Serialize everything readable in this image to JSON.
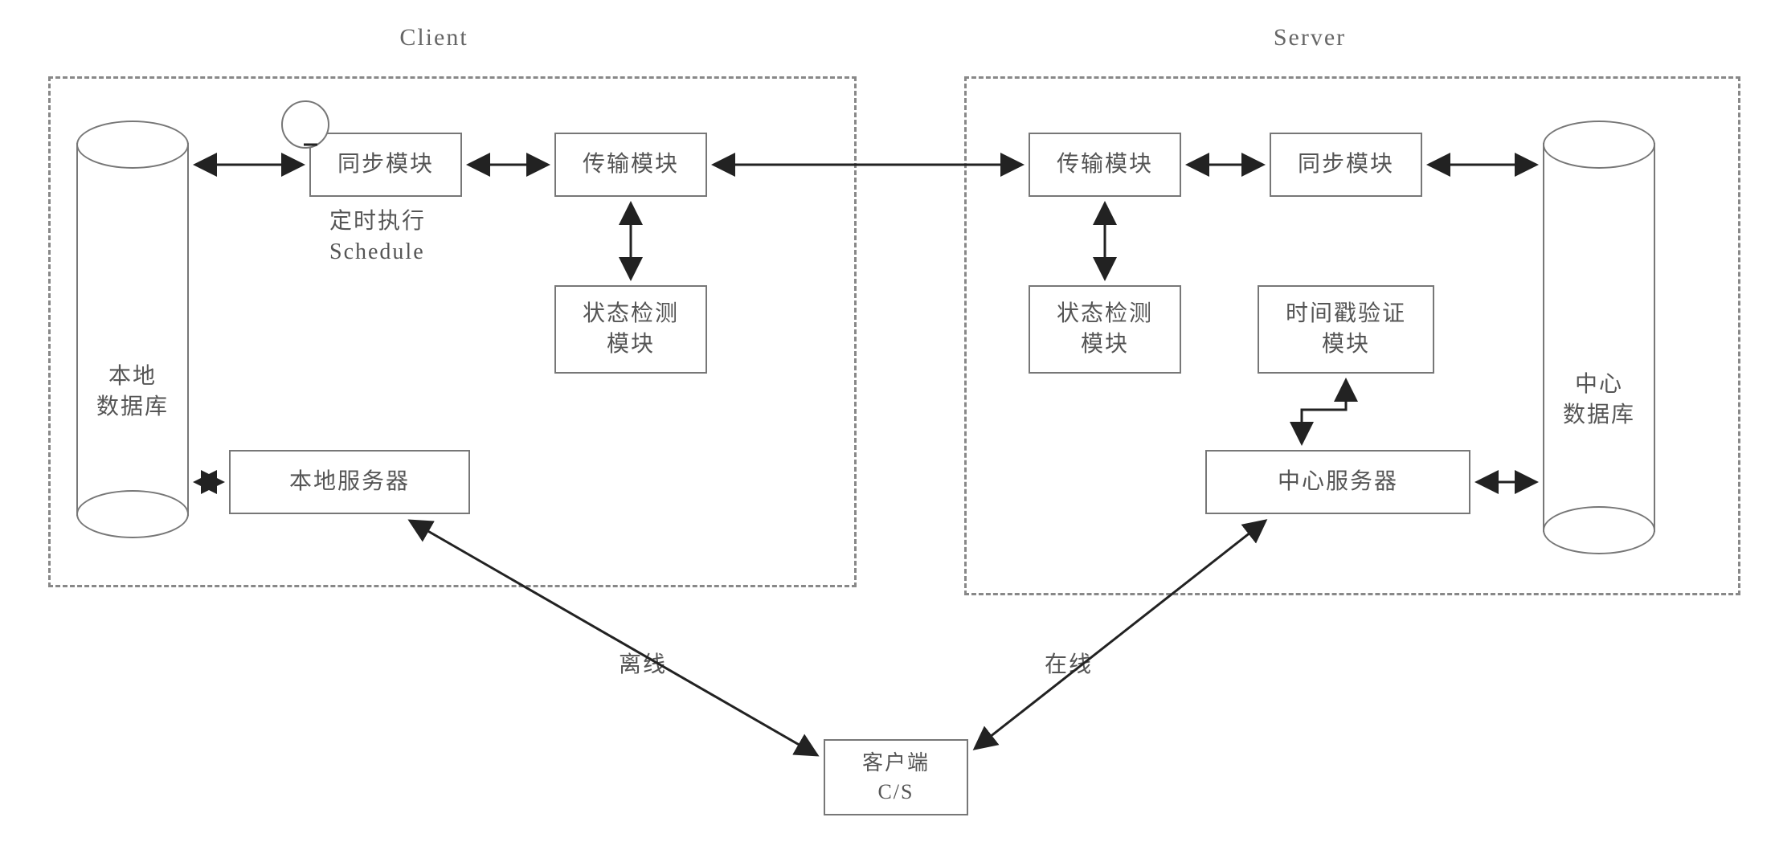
{
  "titles": {
    "client": "Client",
    "server": "Server"
  },
  "client": {
    "db": "本地\n数据库",
    "sync": "同步模块",
    "schedule_cn": "定时执行",
    "schedule_en": "Schedule",
    "transport": "传输模块",
    "status": "状态检测\n模块",
    "local_server": "本地服务器"
  },
  "server": {
    "transport": "传输模块",
    "sync": "同步模块",
    "db": "中心\n数据库",
    "status": "状态检测\n模块",
    "timestamp": "时间戳验证\n模块",
    "center_server": "中心服务器"
  },
  "edges": {
    "offline": "离线",
    "online": "在线"
  },
  "bottom": {
    "client_label": "客户端",
    "cs": "C/S"
  }
}
